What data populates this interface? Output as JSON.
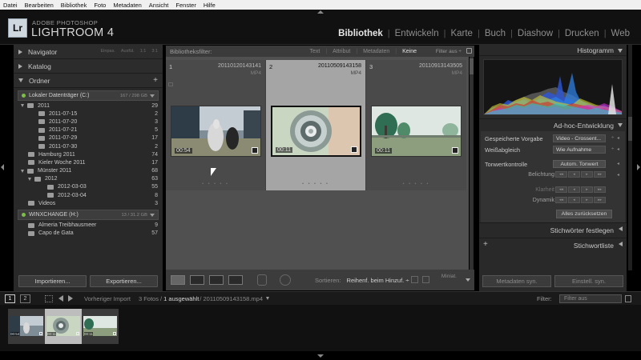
{
  "os_menu": [
    "Datei",
    "Bearbeiten",
    "Bibliothek",
    "Foto",
    "Metadaten",
    "Ansicht",
    "Fenster",
    "Hilfe"
  ],
  "brand": {
    "badge": "Lr",
    "vendor": "ADOBE PHOTOSHOP",
    "product": "LIGHTROOM 4"
  },
  "modules": [
    {
      "label": "Bibliothek",
      "active": true
    },
    {
      "label": "Entwickeln",
      "active": false
    },
    {
      "label": "Karte",
      "active": false
    },
    {
      "label": "Buch",
      "active": false
    },
    {
      "label": "Diashow",
      "active": false
    },
    {
      "label": "Drucken",
      "active": false
    },
    {
      "label": "Web",
      "active": false
    }
  ],
  "left_panel": {
    "navigator": {
      "title": "Navigator",
      "zoom_options": [
        "Einpas.",
        "Ausfül.",
        "1:1",
        "3:1"
      ]
    },
    "catalog": {
      "title": "Katalog"
    },
    "folders": {
      "title": "Ordner",
      "volumes": [
        {
          "name": "Lokaler Datenträger (C:)",
          "size": "167 / 298 GB",
          "items": [
            {
              "name": "2011",
              "count": "29",
              "level": 0,
              "expanded": true
            },
            {
              "name": "2011-07-15",
              "count": "2",
              "level": 2
            },
            {
              "name": "2011-07-20",
              "count": "3",
              "level": 2
            },
            {
              "name": "2011-07-21",
              "count": "5",
              "level": 2
            },
            {
              "name": "2011-07-29",
              "count": "17",
              "level": 2
            },
            {
              "name": "2011-07-30",
              "count": "2",
              "level": 2
            },
            {
              "name": "Hamburg 2011",
              "count": "74",
              "level": 1
            },
            {
              "name": "Kieler Woche 2011",
              "count": "17",
              "level": 1
            },
            {
              "name": "Münster 2011",
              "count": "68",
              "level": 0,
              "expanded": true
            },
            {
              "name": "2012",
              "count": "63",
              "level": 1,
              "expanded": true
            },
            {
              "name": "2012-03-03",
              "count": "55",
              "level": 3
            },
            {
              "name": "2012-03-04",
              "count": "8",
              "level": 3
            },
            {
              "name": "Videos",
              "count": "3",
              "level": 1
            }
          ]
        },
        {
          "name": "WINXCHANGE (H:)",
          "size": "13 / 31.2 GB",
          "items": [
            {
              "name": "Almeria Treibhausmeer",
              "count": "9",
              "level": 1
            },
            {
              "name": "Capo de Gata",
              "count": "57",
              "level": 1
            }
          ]
        }
      ]
    },
    "buttons": {
      "import": "Importieren...",
      "export": "Exportieren..."
    }
  },
  "filter_bar": {
    "label": "Bibliotheksfilter:",
    "options": [
      {
        "label": "Text",
        "active": false
      },
      {
        "label": "Attribut",
        "active": false
      },
      {
        "label": "Metadaten",
        "active": false
      },
      {
        "label": "Keine",
        "active": true
      }
    ],
    "preset": "Filter aus ÷"
  },
  "grid": {
    "cells": [
      {
        "index": "1",
        "filename": "20110120143141",
        "ext": "MP4",
        "duration": "00:54",
        "selected": false
      },
      {
        "index": "2",
        "filename": "20110509143158",
        "ext": "MP4",
        "duration": "00:11",
        "selected": true
      },
      {
        "index": "3",
        "filename": "20110913143505",
        "ext": "MP4",
        "duration": "00:11",
        "selected": false
      }
    ]
  },
  "toolbar": {
    "sort_label": "Sortieren:",
    "sort_value": "Reihenf. beim Hinzuf. ÷",
    "miniatures": "Miniat."
  },
  "right_panel": {
    "histogram_title": "Histogramm",
    "quick_develop_title": "Ad-hoc-Entwicklung",
    "saved_preset_label": "Gespeicherte Vorgabe",
    "saved_preset_value": "Video - Crossent...",
    "white_balance_label": "Weißabgleich",
    "white_balance_value": "Wie Aufnahme",
    "tone_control_label": "Tonwertkontrolle",
    "auto_tone": "Autom. Tonwert",
    "exposure_label": "Belichtung",
    "clarity_label": "Klarheit",
    "vibrance_label": "Dynamik",
    "reset_all": "Alles zurücksetzen",
    "keywording": "Stichwörter festlegen",
    "keyword_list": "Stichwortliste",
    "sync_metadata": "Metadaten syn.",
    "sync_settings": "Einstell. syn."
  },
  "filmstrip": {
    "screen_1": "1",
    "screen_2": "2",
    "source": "Vorheriger Import",
    "count": "3 Fotos /",
    "selected": "1 ausgewählt",
    "file": "/ 20110509143158.mp4",
    "filter_label": "Filter:",
    "filter_value": "Filter aus",
    "thumbs": [
      {
        "duration": "00:54",
        "selected": false
      },
      {
        "duration": "00:11",
        "selected": true
      },
      {
        "duration": "00:11",
        "selected": false
      }
    ]
  }
}
